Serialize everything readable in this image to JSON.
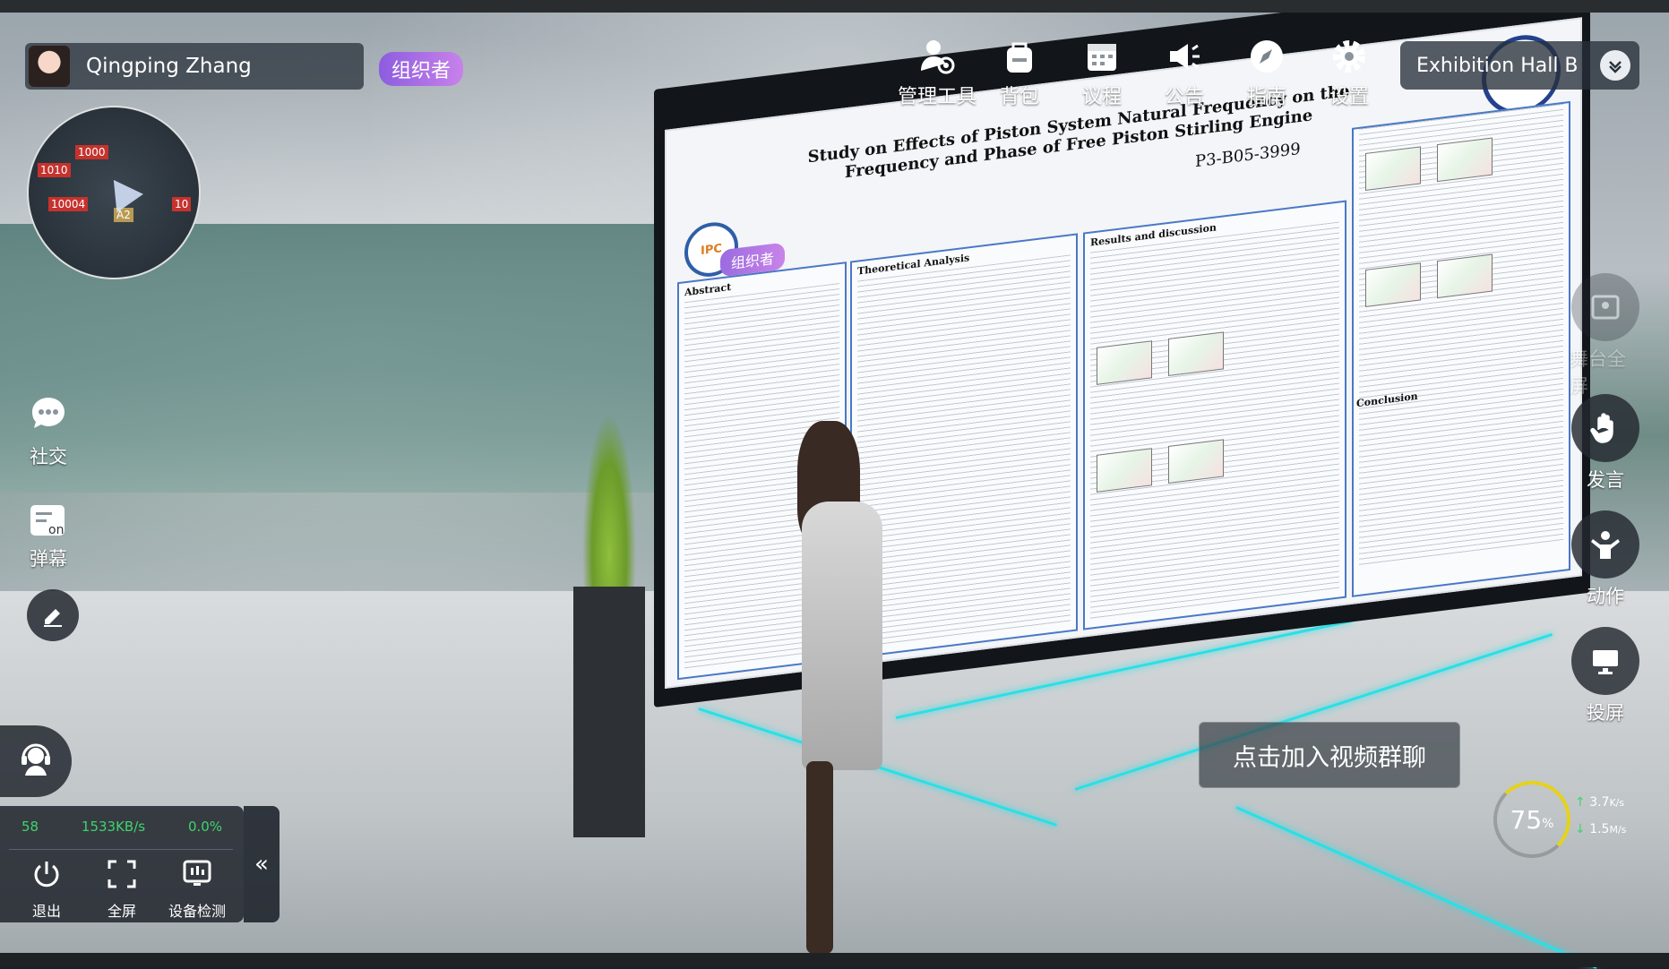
{
  "user": {
    "name": "Qingping Zhang",
    "role": "组织者"
  },
  "minimap": {
    "tags": [
      "1010",
      "1000",
      "10004",
      "A2",
      "10"
    ]
  },
  "toolbar": {
    "items": [
      {
        "label": "管理工具",
        "icon": "admin-tools-icon"
      },
      {
        "label": "背包",
        "icon": "backpack-icon"
      },
      {
        "label": "议程",
        "icon": "calendar-icon"
      },
      {
        "label": "公告",
        "icon": "megaphone-icon"
      },
      {
        "label": "指南",
        "icon": "compass-icon"
      },
      {
        "label": "设置",
        "icon": "gear-icon"
      }
    ]
  },
  "hall": {
    "name": "Exhibition Hall B"
  },
  "left": {
    "social": "社交",
    "danmu": "弹幕",
    "danmu_on": "on"
  },
  "right": {
    "stage_fullscreen": "舞台全屏",
    "speak": "发言",
    "action": "动作",
    "screen_cast": "投屏"
  },
  "poster": {
    "title": "Study on Effects of Piston System Natural Frequency on the Frequency and Phase of Free Piston Stirling Engine",
    "code": "P3-B05-3999",
    "logo": "IPC",
    "badge": "组织者",
    "sections": [
      "Abstract",
      "Results and discussion",
      "Theoretical Analysis",
      "Conclusion"
    ]
  },
  "video_join": "点击加入视频群聊",
  "network": {
    "percent": "75",
    "unit": "%",
    "up": "3.7",
    "up_unit": "K/s",
    "down": "1.5",
    "down_unit": "M/s"
  },
  "panel": {
    "fps": "58",
    "bandwidth": "1533KB/s",
    "loss": "0.0%",
    "exit": "退出",
    "fullscreen": "全屏",
    "device_check": "设备检测",
    "collapse": "«"
  },
  "colors": {
    "accent_purple": "#9b6be0",
    "teal_light": "#29e0e6",
    "stat_green": "#3ed46b"
  }
}
